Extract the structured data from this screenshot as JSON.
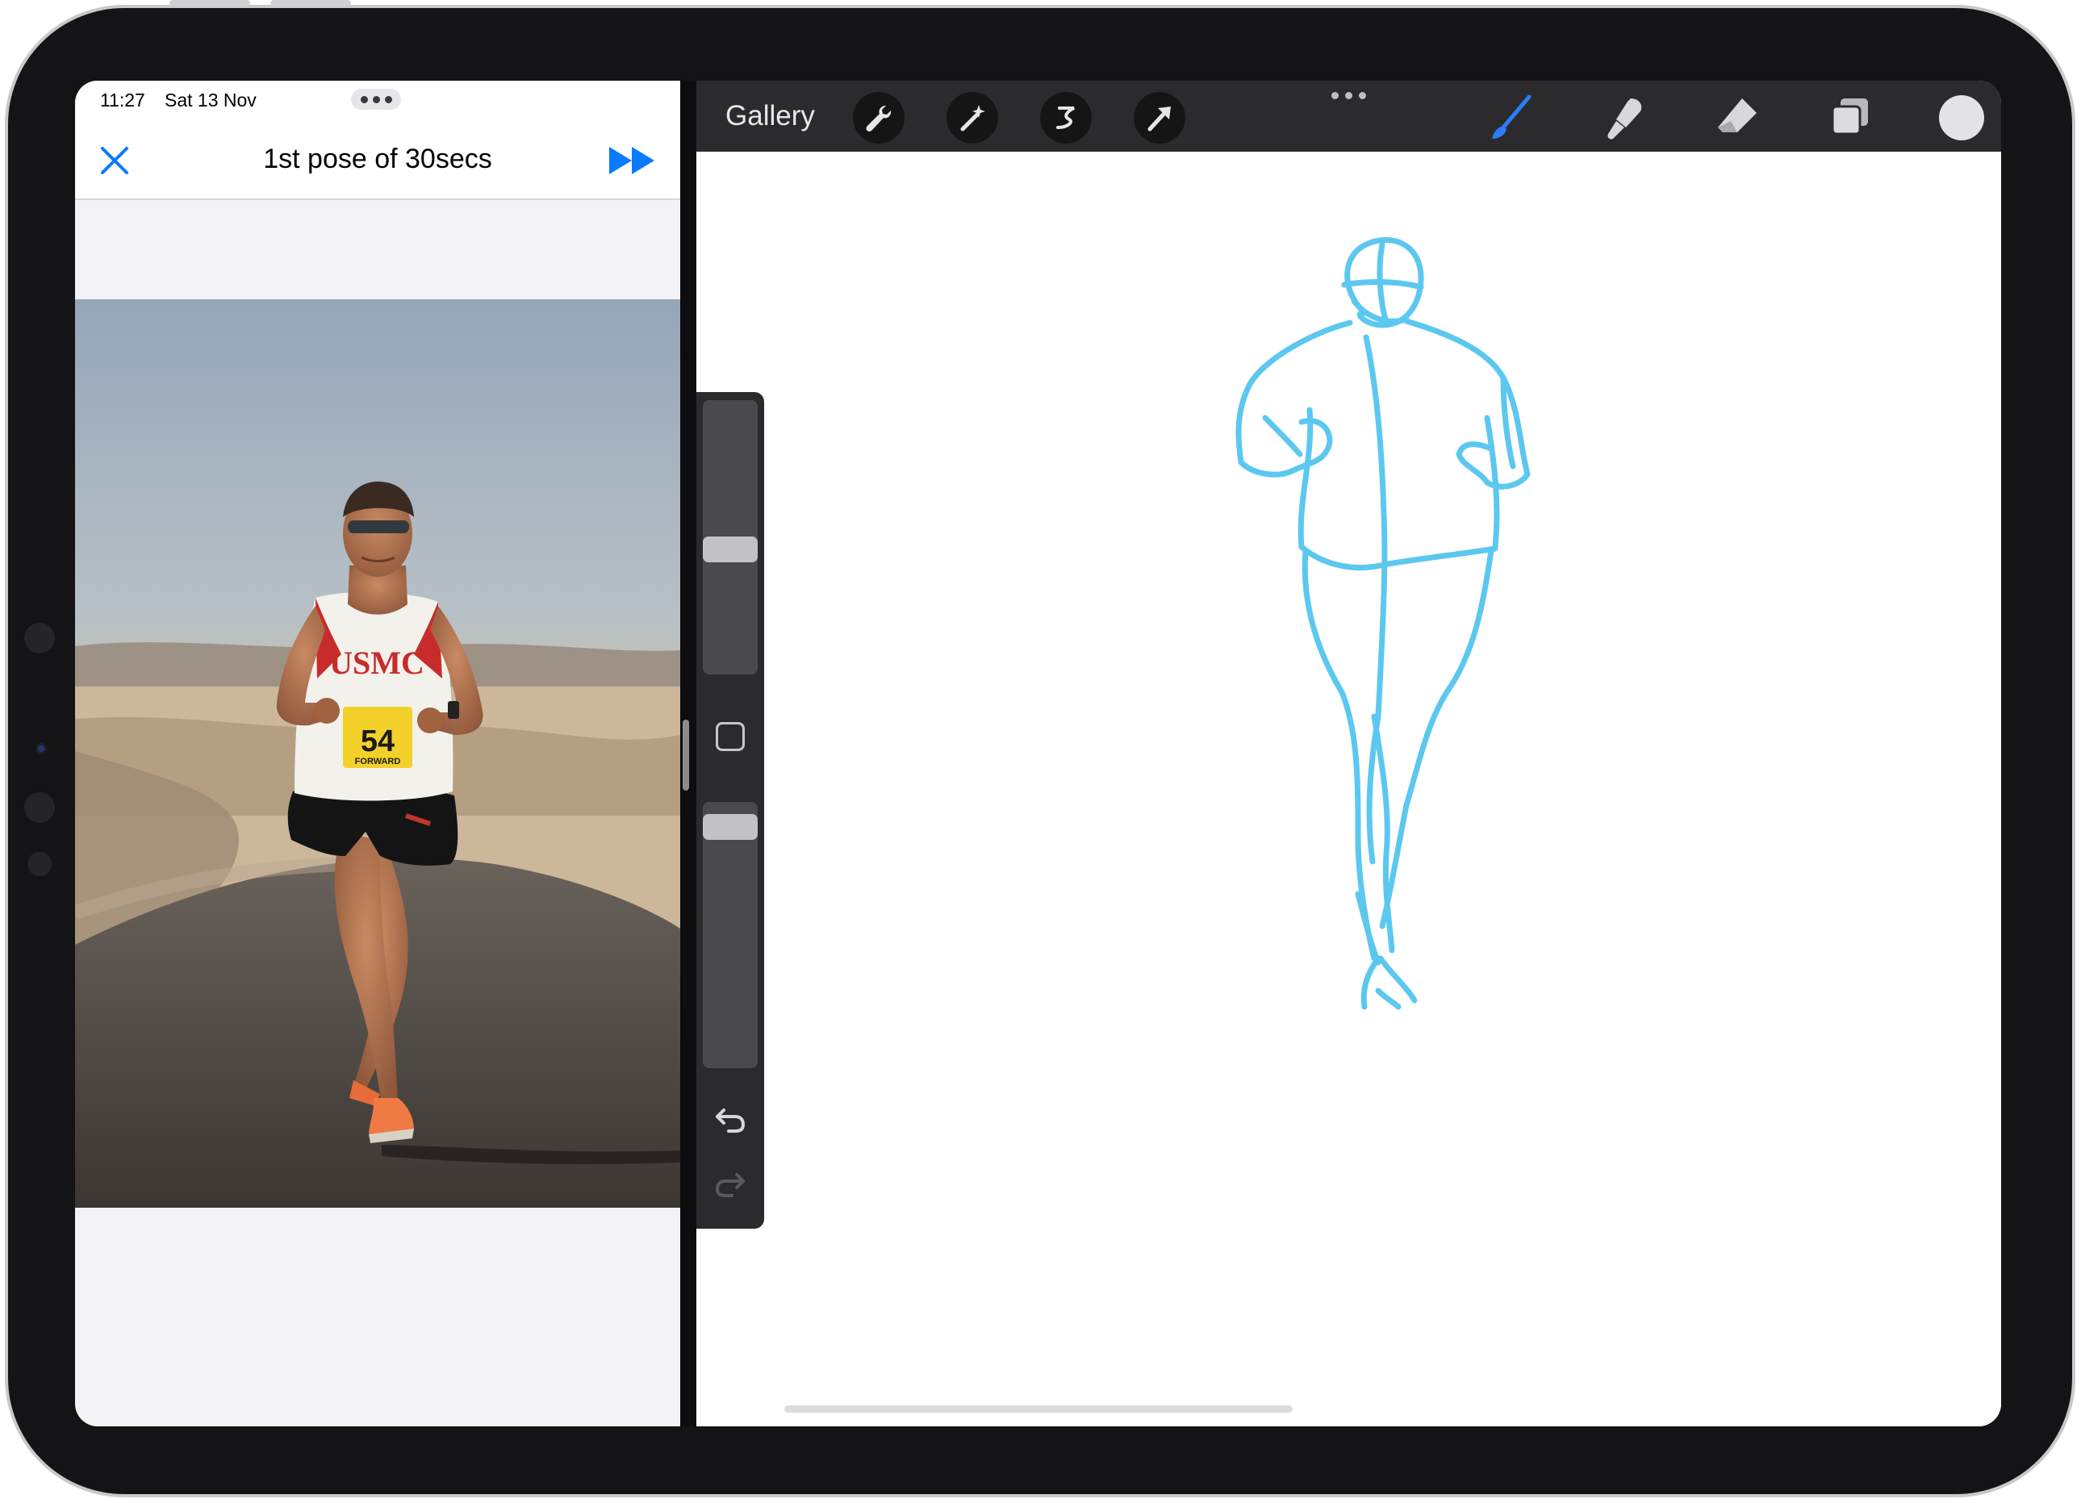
{
  "reference_app": {
    "status_bar": {
      "time": "11:27",
      "date": "Sat 13 Nov",
      "multitasking_icon": "ellipsis-icon"
    },
    "nav": {
      "close_icon": "close-icon",
      "title": "1st pose of 30secs",
      "next_icon": "fast-forward-icon",
      "accent_color": "#0a7aff"
    },
    "photo": {
      "subject": "runner",
      "shirt_text": "USMC",
      "bib_number": "54",
      "bib_sponsor": "FORWARD"
    }
  },
  "drawing_app": {
    "toolbar": {
      "gallery_label": "Gallery",
      "left_tools": [
        "wrench-icon",
        "magic-wand-icon",
        "selection-icon",
        "transform-arrow-icon"
      ],
      "more_icon": "ellipsis-icon",
      "right_tools": [
        "brush-icon",
        "smudge-icon",
        "eraser-icon",
        "layers-icon"
      ],
      "active_tool": "brush",
      "current_color": "#e3e3e5"
    },
    "side_panel": {
      "brush_size_level": 0.45,
      "opacity_level": 0.95,
      "modify_icon": "square-icon",
      "undo_icon": "undo-icon",
      "redo_icon": "redo-icon"
    },
    "sketch": {
      "subject": "gesture drawing of runner",
      "stroke_color": "#5cc8f0"
    }
  }
}
